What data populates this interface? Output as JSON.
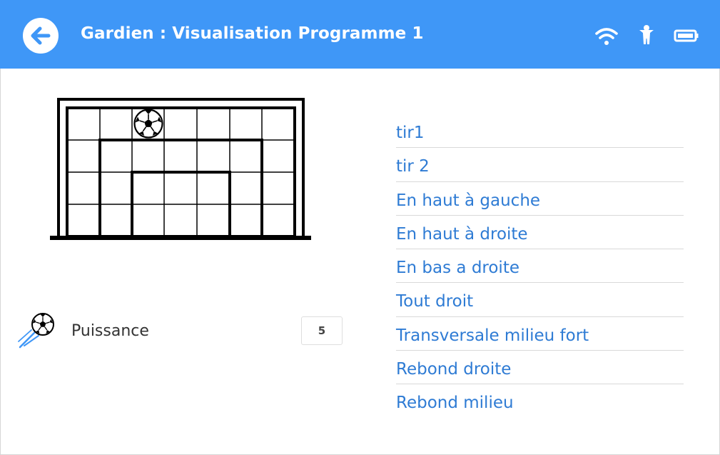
{
  "header": {
    "title": "Gardien : Visualisation Programme 1",
    "background_color": "#3f97f7",
    "back_icon": "arrow-left-icon",
    "status_icons": [
      "wifi-icon",
      "person-icon",
      "battery-icon"
    ]
  },
  "goal": {
    "ball_icon": "soccer-ball-icon",
    "ball_cell": {
      "row": 1,
      "column": 3
    },
    "grid_rows": 4,
    "grid_columns": 7
  },
  "power": {
    "icon": "kicked-ball-icon",
    "label": "Puissance",
    "value": "5"
  },
  "shots": [
    {
      "label": "tir1"
    },
    {
      "label": "tir 2"
    },
    {
      "label": "En haut à gauche"
    },
    {
      "label": "En haut à droite"
    },
    {
      "label": "En bas a droite"
    },
    {
      "label": "Tout droit"
    },
    {
      "label": "Transversale milieu fort"
    },
    {
      "label": "Rebond droite"
    },
    {
      "label": "Rebond milieu"
    }
  ],
  "colors": {
    "accent": "#3f97f7",
    "link": "#2e7bd4"
  }
}
